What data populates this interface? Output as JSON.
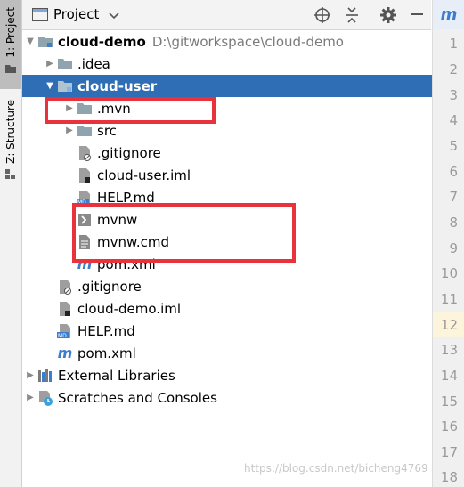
{
  "sidebar": {
    "tabs": [
      {
        "label": "1: Project"
      },
      {
        "label": "Z: Structure"
      }
    ]
  },
  "header": {
    "title": "Project"
  },
  "tree": [
    {
      "label": "cloud-demo",
      "path": "D:\\gitworkspace\\cloud-demo",
      "icon": "module-folder-icon",
      "expanded": true,
      "bold": true
    },
    {
      "label": ".idea",
      "icon": "folder-icon"
    },
    {
      "label": "cloud-user",
      "icon": "module-folder-icon",
      "expanded": true,
      "bold": true,
      "selected": true
    },
    {
      "label": ".mvn",
      "icon": "folder-icon"
    },
    {
      "label": "src",
      "icon": "folder-icon"
    },
    {
      "label": ".gitignore",
      "icon": "gitignore-file-icon"
    },
    {
      "label": "cloud-user.iml",
      "icon": "iml-file-icon"
    },
    {
      "label": "HELP.md",
      "icon": "markdown-file-icon"
    },
    {
      "label": "mvnw",
      "icon": "shell-script-icon"
    },
    {
      "label": "mvnw.cmd",
      "icon": "text-file-icon"
    },
    {
      "label": "pom.xml",
      "icon": "maven-icon"
    },
    {
      "label": ".gitignore",
      "icon": "gitignore-file-icon"
    },
    {
      "label": "cloud-demo.iml",
      "icon": "iml-file-icon"
    },
    {
      "label": "HELP.md",
      "icon": "markdown-file-icon"
    },
    {
      "label": "pom.xml",
      "icon": "maven-icon"
    },
    {
      "label": "External Libraries",
      "icon": "libraries-icon"
    },
    {
      "label": "Scratches and Consoles",
      "icon": "scratches-icon"
    }
  ],
  "gutter": {
    "lines": [
      "1",
      "2",
      "3",
      "4",
      "5",
      "6",
      "7",
      "8",
      "9",
      "10",
      "11",
      "12",
      "13",
      "14",
      "15",
      "16",
      "17",
      "18"
    ],
    "current_line": "12"
  },
  "watermark": "https://blog.csdn.net/bicheng4769",
  "colors": {
    "selection": "#2f6db4",
    "highlight_box": "#e8323c",
    "folder": "#90a4ae",
    "maven": "#3c7ecd"
  }
}
